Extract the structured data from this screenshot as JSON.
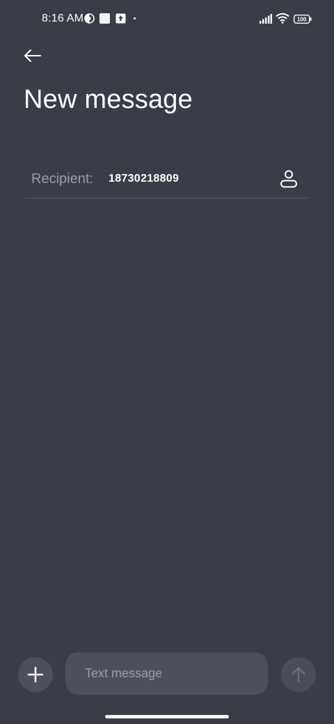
{
  "status_bar": {
    "time": "8:16 AM",
    "battery": "100",
    "icons": [
      "contrast-icon",
      "square-notification-icon",
      "upload-icon",
      "dot-icon",
      "signal-icon",
      "wifi-icon",
      "battery-icon"
    ]
  },
  "header": {
    "back_icon": "back-arrow-icon",
    "title": "New message"
  },
  "recipient": {
    "label": "Recipient:",
    "value": "18730218809",
    "contact_icon": "contact-person-icon"
  },
  "compose": {
    "add_icon": "plus-icon",
    "placeholder": "Text message",
    "send_icon": "send-arrow-icon"
  },
  "colors": {
    "background": "#3a3c47",
    "input_background": "#4d505c",
    "muted_text": "#9a9ca7",
    "divider": "#565967"
  }
}
